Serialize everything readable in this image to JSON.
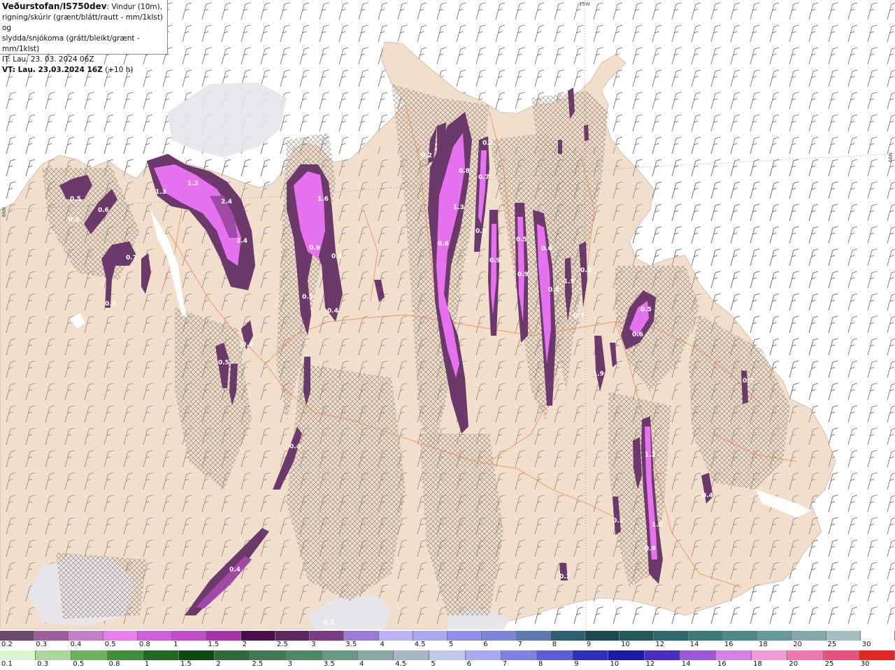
{
  "title": {
    "source": "Veðurstofan/IS750dev",
    "line1_rest": ": Vindur (10m),",
    "line2": "rigning/skúrir (grænt/blátt/rautt - mm/1klst) og",
    "line3": "slydda/snjókoma (grátt/bleikt/grænt - mm/1klst)",
    "line4": "IT: Lau. 23. 03. 2024 06Z",
    "line5_bold": "VT: Lau. 23.03.2024 16Z",
    "line5_rest": " (+10 h)"
  },
  "grid_labels": {
    "lon": "15W",
    "lat_right": "66N",
    "lat_left": "66N"
  },
  "colors": {
    "land": "#f1dfcc",
    "sea": "#ffffff",
    "roads": "#e8875a",
    "snow_light": "#e8e8ec",
    "precip_dark": "#6b3a6b",
    "precip_mid": "#a04aa8",
    "precip_bright": "#e772ef"
  },
  "snow_scale": {
    "ticks": [
      "0.2",
      "0.3",
      "0.4",
      "0.5",
      "0.8",
      "1",
      "1.5",
      "2",
      "2.5",
      "3",
      "3.5",
      "4",
      "4.5",
      "5",
      "6",
      "7",
      "8",
      "9",
      "10",
      "12",
      "14",
      "16",
      "18",
      "20",
      "25",
      "30"
    ],
    "colors": [
      "#6b4a6b",
      "#9b5f9b",
      "#c47fcc",
      "#e77ef0",
      "#cf5fd8",
      "#c34cc9",
      "#a534a8",
      "#4a0d4a",
      "#5c2860",
      "#7a3b85",
      "#9b7bd6",
      "#bcb4f5",
      "#a9a9f0",
      "#8f8fe8",
      "#7c86d8",
      "#5c7bb3",
      "#2f5f73",
      "#1c4a52",
      "#23585b",
      "#2e6a6c",
      "#3a7a78",
      "#4d8a88",
      "#66999a",
      "#82aaaa",
      "#a5bfbf",
      "#ffffff"
    ]
  },
  "rain_scale": {
    "ticks": [
      "0.1",
      "0.3",
      "0.5",
      "0.8",
      "1",
      "1.5",
      "2",
      "2.5",
      "3",
      "3.5",
      "4",
      "4.5",
      "5",
      "6",
      "7",
      "8",
      "9",
      "10",
      "12",
      "14",
      "16",
      "18",
      "20",
      "25",
      "30"
    ],
    "colors": [
      "#d8f5d0",
      "#a7d89a",
      "#6ab45e",
      "#3d8f3a",
      "#1f6a22",
      "#0b4a12",
      "#2d6b3a",
      "#3f7a52",
      "#4f8866",
      "#6a9a85",
      "#8aa9a5",
      "#a7b7c5",
      "#c2c8e8",
      "#a9a9f0",
      "#7f80e3",
      "#5c5cd6",
      "#2f2fbf",
      "#1a1aa8",
      "#4a2ec0",
      "#9a58d9",
      "#d880e8",
      "#f29ad6",
      "#f07ab0",
      "#ec4f7e",
      "#e52424"
    ]
  },
  "precip_labels": [
    "1.2",
    "1.3",
    "2.4",
    "2.4",
    "0.5",
    "0.6",
    "0.5",
    "0.7",
    "0.5",
    "1.6",
    "0.9",
    "0.4",
    "0.5",
    "0.4",
    "0.4",
    "0.5",
    "0.4",
    "0.4",
    "0.2",
    "0.2",
    "0.8",
    "0.7",
    "1.3",
    "0.6",
    "0.5",
    "0.9",
    "0.9",
    "0.6",
    "0.5",
    "0.2",
    "1.9",
    "1.9",
    "0.2",
    "0.5",
    "0.6",
    "0.7",
    "0.2",
    "1.2",
    "1.8",
    "0.9",
    "0.4",
    "0.2",
    "0.2",
    "0.3"
  ]
}
